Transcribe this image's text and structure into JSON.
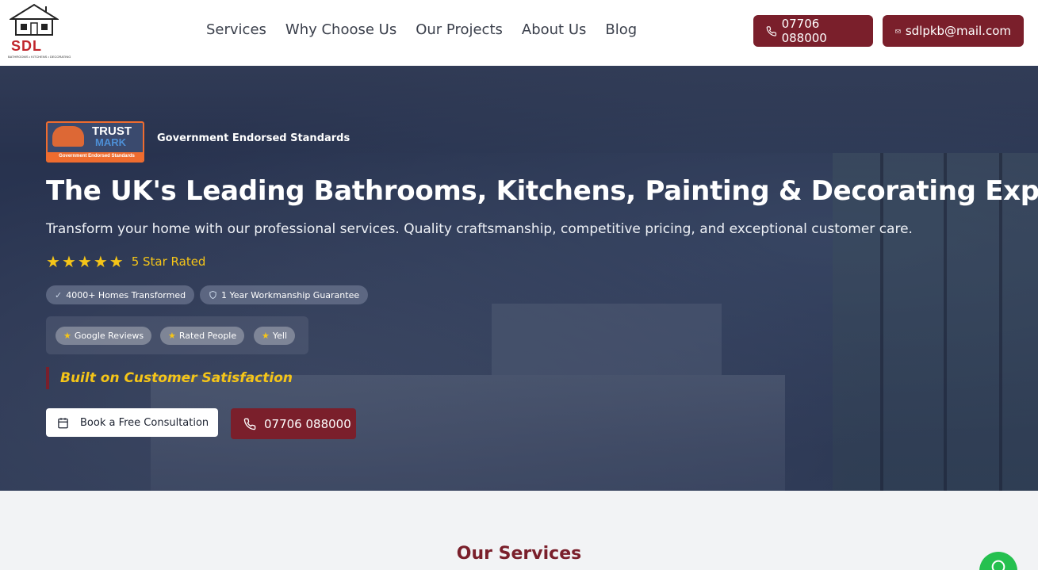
{
  "header": {
    "logo": {
      "brand": "SDL",
      "tagline": "BATHROOMS • KITCHENS • DECORATING"
    },
    "nav": [
      "Services",
      "Why Choose Us",
      "Our Projects",
      "About Us",
      "Blog"
    ],
    "phone_label": "07706 088000",
    "email_label": "sdlpkb@mail.com"
  },
  "hero": {
    "trustmark": {
      "line1": "TRUST",
      "line2": "MARK",
      "line3": "Government Endorsed Standards"
    },
    "gov_label": "Government Endorsed Standards",
    "title": "The UK's Leading Bathrooms, Kitchens, Painting & Decorating Experts",
    "subtitle": "Transform your home with our professional services. Quality craftsmanship, competitive pricing, and exceptional customer care.",
    "rating": {
      "stars": 5,
      "label": "5 Star Rated"
    },
    "badges": [
      "4000+ Homes Transformed",
      "1 Year Workmanship Guarantee"
    ],
    "reviews": [
      "Google Reviews",
      "Rated People",
      "Yell"
    ],
    "tagline": "Built on Customer Satisfaction",
    "cta_consult": "Book a Free Consultation",
    "cta_phone": "07706 088000"
  },
  "services": {
    "title": "Our Services"
  },
  "colors": {
    "brand": "#7a1f2b",
    "star": "#f5c518",
    "chat": "#25c04f"
  },
  "icons": {
    "phone": "phone-icon",
    "mail": "mail-icon",
    "calendar": "calendar-icon",
    "check": "check-icon",
    "shield": "shield-icon",
    "star": "star-icon",
    "chat": "chat-icon"
  }
}
